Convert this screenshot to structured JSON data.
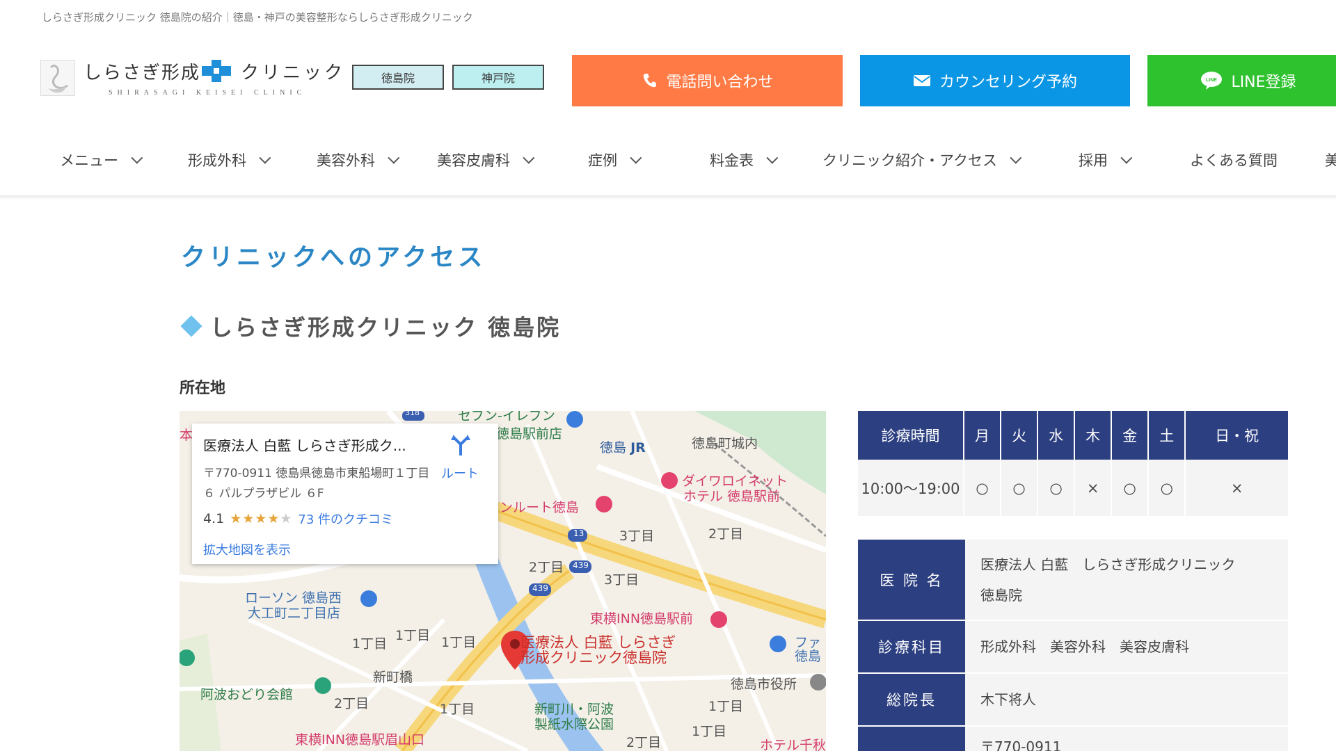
{
  "tagline": "しらさぎ形成クリニック 徳島院の紹介｜徳島・神戸の美容整形ならしらさぎ形成クリニック",
  "header": {
    "logo_name_a": "しらさぎ形成",
    "logo_name_b": "クリニック",
    "logo_sub": "SHIRASAGI KEISEI CLINIC",
    "branches": [
      "徳島院",
      "神戸院"
    ],
    "cta_tel": "電話問い合わせ",
    "cta_counsel": "カウンセリング予約",
    "cta_line": "LINE登録",
    "cta_line_badge": "LINE",
    "colors": {
      "tel": "#ff7a45",
      "counsel": "#0a96e5",
      "line": "#2fc22f",
      "navy": "#2c3f80"
    }
  },
  "nav": {
    "items": [
      {
        "label": "メニュー"
      },
      {
        "label": "形成外科"
      },
      {
        "label": "美容外科"
      },
      {
        "label": "美容皮膚科"
      },
      {
        "label": "症例"
      },
      {
        "label": "料金表"
      },
      {
        "label": "クリニック紹介・アクセス"
      },
      {
        "label": "採用"
      },
      {
        "label": "よくある質問"
      },
      {
        "label": "美"
      }
    ]
  },
  "main": {
    "access_title": "クリニックへのアクセス",
    "clinic_heading": "しらさぎ形成クリニック 徳島院",
    "location_label": "所在地"
  },
  "map": {
    "card": {
      "name": "医療法人 白藍 しらさぎ形成ク...",
      "address": "〒770-0911 徳島県徳島市東船場町１丁目６ パルプラザビル ６F",
      "route": "ルート",
      "rating": "4.1",
      "stars_on": "★★★★",
      "stars_off": "★",
      "reviews": "73 件のクチコミ",
      "enlarge": "拡大地図を表示"
    },
    "labels": {
      "seven": "セブン-イレブン",
      "station_front": "徳島駅前店",
      "tokushima": "徳島",
      "jr": "JR",
      "castle": "徳島町城内",
      "daiwa_1": "ダイワロイネット",
      "daiwa_2": "ホテル 徳島駅前",
      "route_inn": "ンルート徳島",
      "c3_1": "3丁目",
      "c2_1": "2丁目",
      "c2_2": "2丁目",
      "c3_2": "3丁目",
      "r13": "13",
      "r439a": "439",
      "r439b": "439",
      "r318": "318",
      "lawson_1": "ローソン 徳島西",
      "lawson_2": "大工町二丁目店",
      "toyoko1": "東横INN徳島駅前",
      "pin_1": "医療法人 白藍 しらさぎ",
      "pin_2": "形成クリニック徳島院",
      "c1_1": "1丁目",
      "c1_2": "1丁目",
      "c1_3": "1丁目",
      "shinmachi": "新町橋",
      "awaodori": "阿波おどり会館",
      "c2_3": "2丁目",
      "c1_4": "1丁目",
      "park_1": "新町川・阿波",
      "park_2": "製紙水際公園",
      "cityhall": "徳島市役所",
      "c1_5": "1丁目",
      "c1_6": "1丁目",
      "c2_4": "2丁目",
      "toyoko2": "東横INN徳島駅眉山口",
      "hotel_chi": "ホテル千秋",
      "fam_1": "ファ",
      "fam_2": "徳島",
      "hon": "本"
    }
  },
  "hours": {
    "headers": [
      "診療時間",
      "月",
      "火",
      "水",
      "木",
      "金",
      "土",
      "日・祝"
    ],
    "row": [
      "10:00〜19:00",
      "○",
      "○",
      "○",
      "×",
      "○",
      "○",
      "×"
    ]
  },
  "info": {
    "rows": [
      {
        "label": "医 院 名",
        "value_1": "医療法人 白藍　しらさぎ形成クリニック",
        "value_2": "徳島院"
      },
      {
        "label": "診療科目",
        "value_1": "形成外科　美容外科　美容皮膚科"
      },
      {
        "label": "総院長",
        "value_1": "木下将人"
      },
      {
        "label": "",
        "value_1": "〒770-0911"
      }
    ]
  }
}
